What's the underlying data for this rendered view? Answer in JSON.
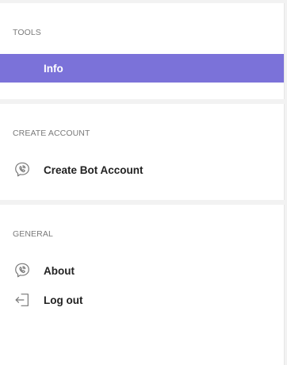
{
  "sections": {
    "tools": {
      "title": "TOOLS",
      "items": [
        {
          "label": "Info",
          "active": true
        }
      ]
    },
    "create_account": {
      "title": "CREATE ACCOUNT",
      "items": [
        {
          "label": "Create Bot Account",
          "icon": "viber-icon"
        }
      ]
    },
    "general": {
      "title": "GENERAL",
      "items": [
        {
          "label": "About",
          "icon": "viber-icon"
        },
        {
          "label": "Log out",
          "icon": "logout-icon"
        }
      ]
    }
  },
  "colors": {
    "active_bg": "#7b72d9",
    "page_bg": "#f2f2f2"
  }
}
